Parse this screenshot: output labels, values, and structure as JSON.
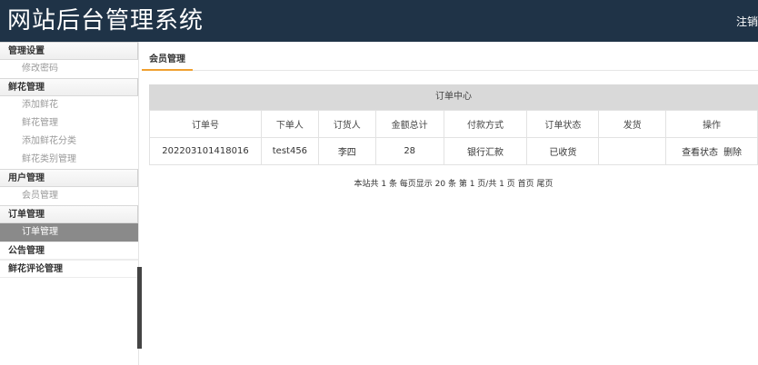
{
  "header": {
    "title": "网站后台管理系统",
    "logout": "注销"
  },
  "sidebar": {
    "groups": [
      {
        "title": "管理设置",
        "items": [
          "修改密码"
        ]
      },
      {
        "title": "鲜花管理",
        "items": [
          "添加鲜花",
          "鲜花管理",
          "添加鲜花分类",
          "鲜花类别管理"
        ]
      },
      {
        "title": "用户管理",
        "items": [
          "会员管理"
        ]
      },
      {
        "title": "订单管理",
        "items": [
          "订单管理"
        ]
      },
      {
        "title": "公告管理",
        "items": []
      },
      {
        "title": "鲜花评论管理",
        "items": []
      }
    ],
    "active_item": "订单管理"
  },
  "tabs": [
    {
      "label": "会员管理"
    }
  ],
  "table": {
    "caption": "订单中心",
    "columns": [
      "订单号",
      "下单人",
      "订货人",
      "金额总计",
      "付款方式",
      "订单状态",
      "发货",
      "操作"
    ],
    "rows": [
      {
        "order_no": "202203101418016",
        "placer": "test456",
        "recipient": "李四",
        "total": "28",
        "payment": "银行汇款",
        "status": "已收货",
        "ship": "",
        "op_view": "查看状态",
        "op_delete": "删除"
      }
    ]
  },
  "pager": {
    "text": "本站共 1 条 每页显示 20 条 第 1 页/共 1 页 首页 尾页"
  },
  "colors": {
    "header_bg": "#1f3347",
    "active_item_bg": "#8a8a8a",
    "tab_underline": "#f0a030",
    "caption_bg": "#d9d9d9"
  }
}
